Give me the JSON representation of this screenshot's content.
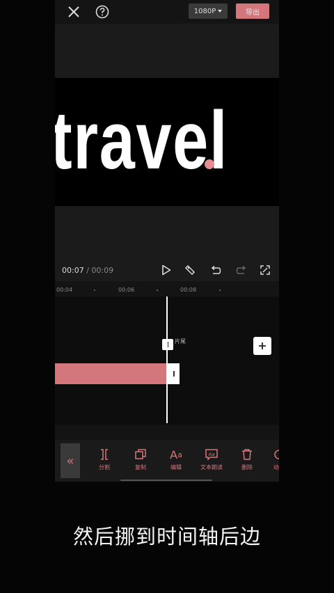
{
  "topbar": {
    "resolution": "1080P",
    "export_label": "导出"
  },
  "preview": {
    "video_text": "travel",
    "current_time": "00:07",
    "separator": " / ",
    "total_time": "00:09"
  },
  "ruler": {
    "ticks": [
      "00:04",
      "00:06",
      "00:08"
    ]
  },
  "timeline": {
    "marker_label": "片尾"
  },
  "toolbar": {
    "tools": [
      {
        "label": "分割",
        "icon": "split-icon"
      },
      {
        "label": "复制",
        "icon": "copy-icon"
      },
      {
        "label": "编辑",
        "icon": "text-edit-icon"
      },
      {
        "label": "文本朗读",
        "icon": "text-to-speech-icon"
      },
      {
        "label": "删除",
        "icon": "delete-icon"
      },
      {
        "label": "动画",
        "icon": "animation-icon"
      }
    ]
  },
  "caption": "然后挪到时间轴后边",
  "colors": {
    "accent": "#d4777c",
    "background": "#050505"
  }
}
